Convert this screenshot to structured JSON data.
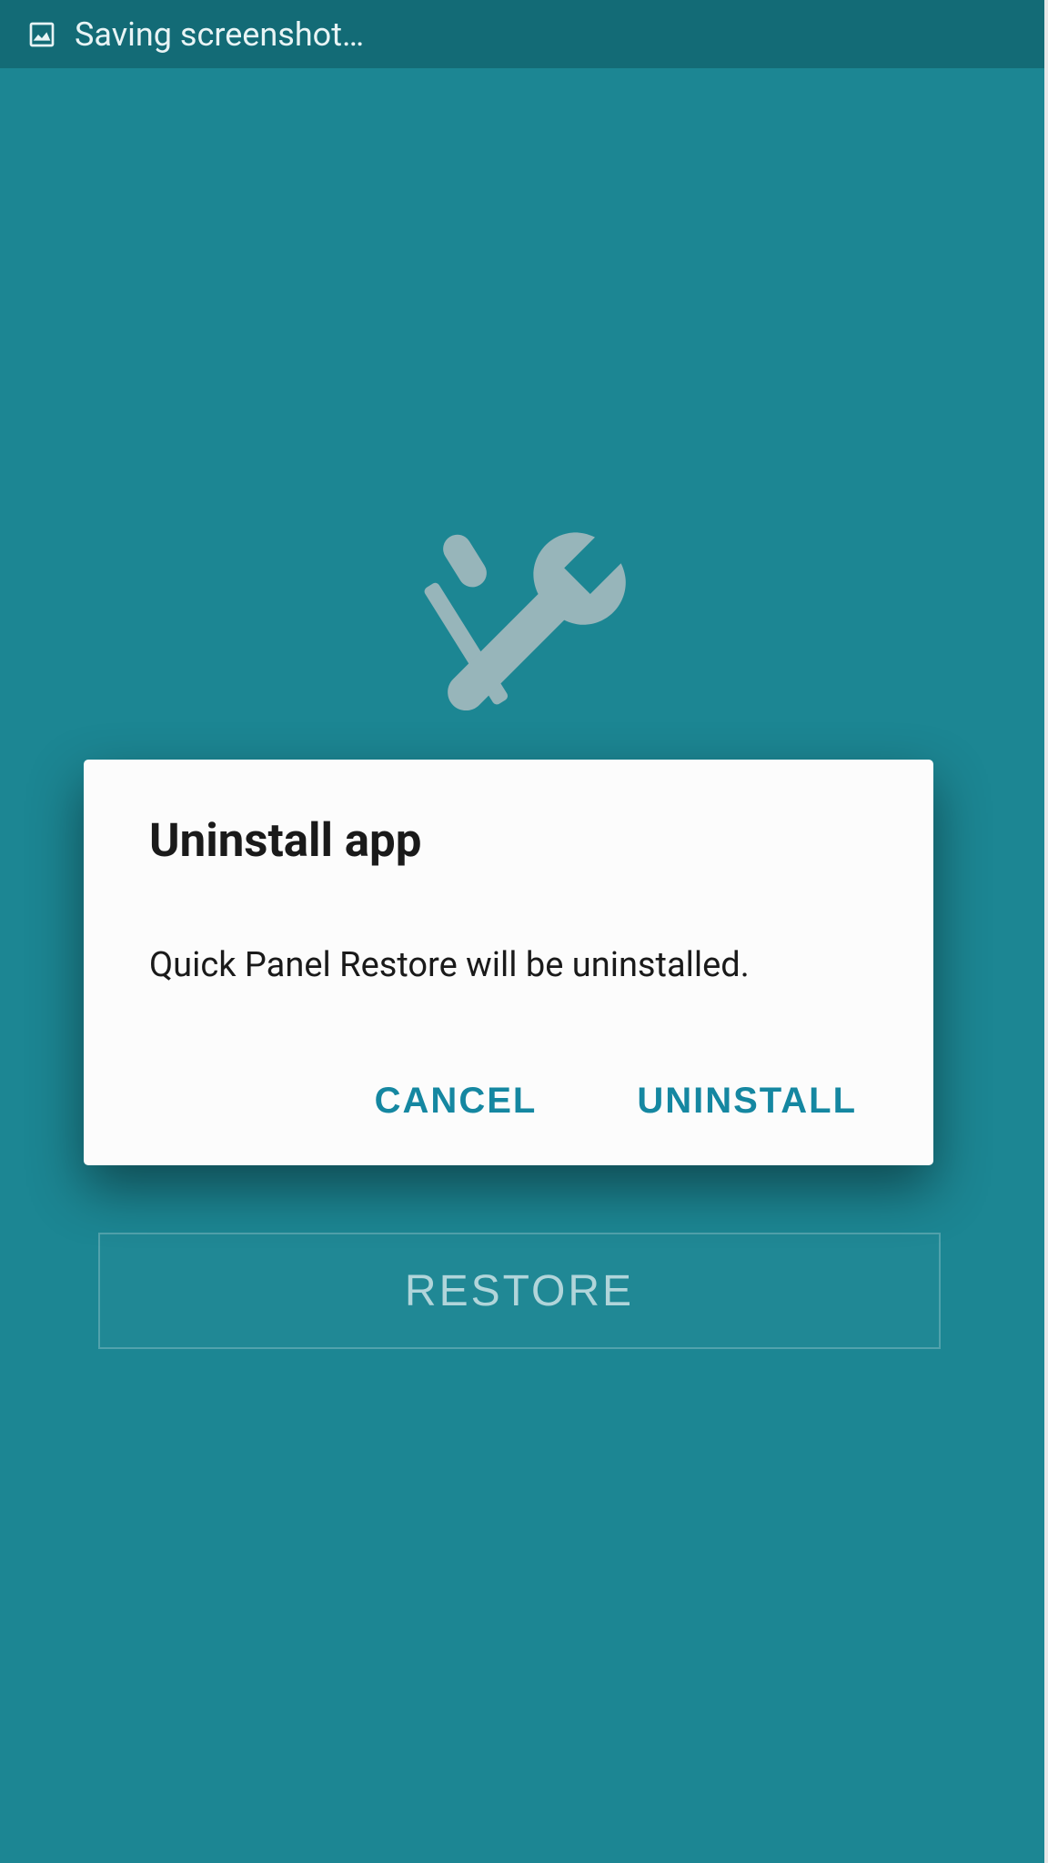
{
  "statusBar": {
    "text": "Saving screenshot…",
    "iconName": "picture-icon"
  },
  "mainScreen": {
    "restoreButtonLabel": "RESTORE",
    "toolsIconName": "tools-icon"
  },
  "dialog": {
    "title": "Uninstall app",
    "message": "Quick Panel Restore will be uninstalled.",
    "cancelLabel": "CANCEL",
    "confirmLabel": "UNINSTALL"
  },
  "colors": {
    "statusBarBg": "#136b76",
    "mainBg": "#1c8693",
    "dialogBg": "#fcfcfc",
    "accentTeal": "#1587a1"
  }
}
